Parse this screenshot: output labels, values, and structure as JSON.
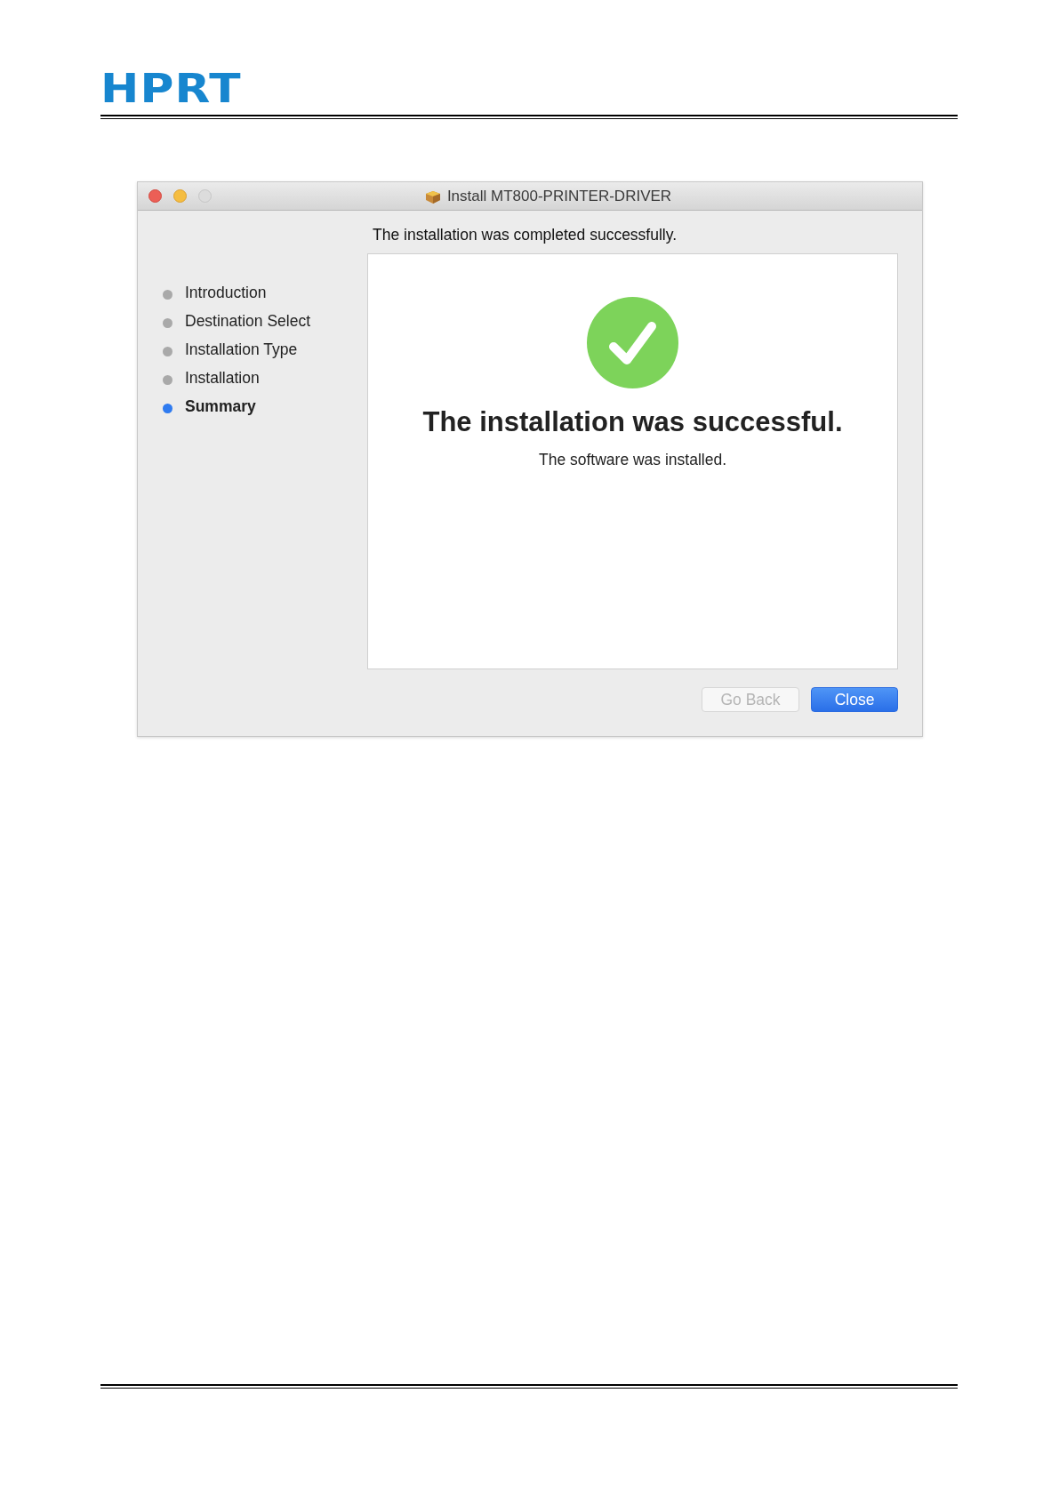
{
  "header": {
    "logo": "HPRT"
  },
  "window": {
    "title": "Install MT800-PRINTER-DRIVER",
    "steps": [
      {
        "label": "Introduction",
        "selected": false
      },
      {
        "label": "Destination Select",
        "selected": false
      },
      {
        "label": "Installation Type",
        "selected": false
      },
      {
        "label": "Installation",
        "selected": false
      },
      {
        "label": "Summary",
        "selected": true
      }
    ],
    "status_text": "The installation was completed successfully.",
    "result_title": "The installation was successful.",
    "result_text": "The software was installed.",
    "buttons": [
      {
        "label": "Go Back",
        "kind": "secondary",
        "disabled": true
      },
      {
        "label": "Close",
        "kind": "primary",
        "disabled": false
      }
    ]
  }
}
